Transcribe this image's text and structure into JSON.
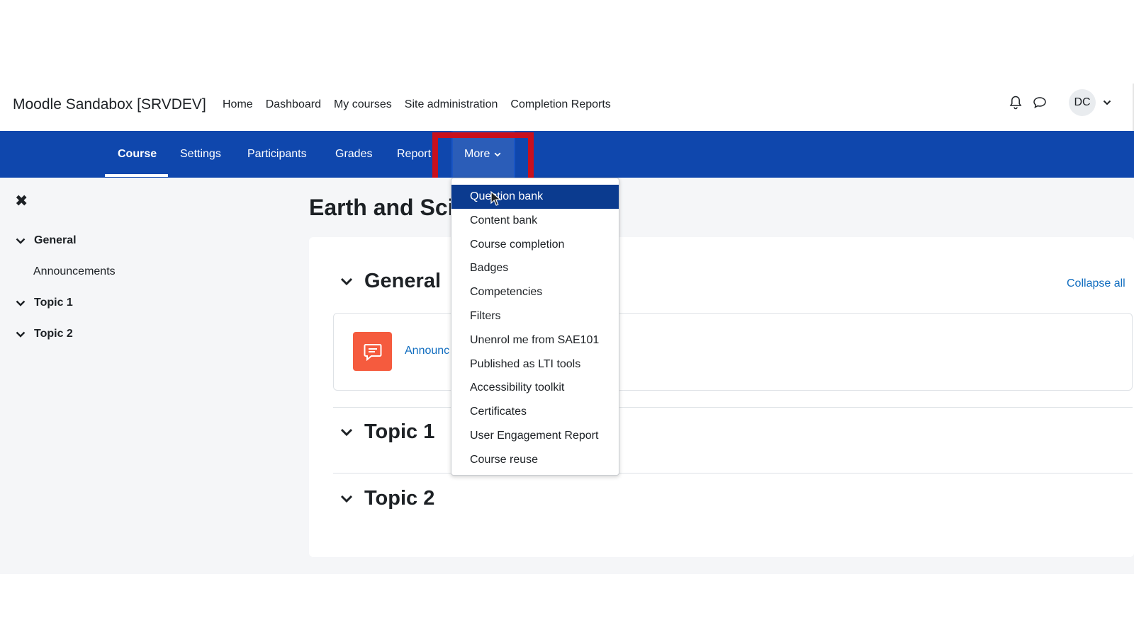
{
  "site": {
    "brand": "Moodle Sandabox [SRVDEV]"
  },
  "primary_nav": [
    "Home",
    "Dashboard",
    "My courses",
    "Site administration",
    "Completion Reports"
  ],
  "user": {
    "initials": "DC"
  },
  "secondary_nav": {
    "tabs": [
      "Course",
      "Settings",
      "Participants",
      "Grades",
      "Report"
    ],
    "active": "Course",
    "more_label": "More"
  },
  "drawer": {
    "items": [
      {
        "label": "General",
        "type": "section"
      },
      {
        "label": "Announcements",
        "type": "activity"
      },
      {
        "label": "Topic 1",
        "type": "section"
      },
      {
        "label": "Topic 2",
        "type": "section"
      }
    ]
  },
  "main": {
    "page_title": "Earth and Sci",
    "collapse_all": "Collapse all",
    "sections": [
      "General",
      "Topic 1",
      "Topic 2"
    ],
    "activity_link": "Announc"
  },
  "dropdown": {
    "items": [
      "Question bank",
      "Content bank",
      "Course completion",
      "Badges",
      "Competencies",
      "Filters",
      "Unenrol me from SAE101",
      "Published as LTI tools",
      "Accessibility toolkit",
      "Certificates",
      "User Engagement Report",
      "Course reuse"
    ],
    "active": "Question bank"
  },
  "colors": {
    "secondary_nav": "#0f47ad",
    "highlight": "#c8101d",
    "dropdown_active": "#0b3b8f",
    "activity_icon": "#f55b3e",
    "link": "#0f6cbf"
  }
}
